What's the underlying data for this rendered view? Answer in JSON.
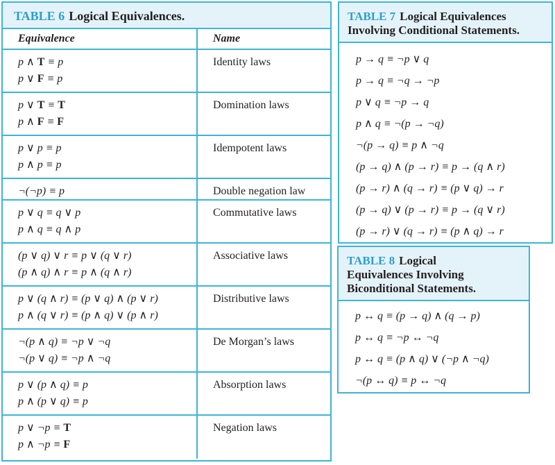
{
  "colors": {
    "border": "#3fb3d6",
    "header_bg": "#e4f3f9",
    "accent": "#2aa0cc",
    "text": "#231f20"
  },
  "table6": {
    "number": "TABLE 6",
    "title": "Logical Equivalences.",
    "headers": {
      "equivalence": "Equivalence",
      "name": "Name"
    },
    "rows": [
      {
        "lines": [
          "p ∧ <b>T</b> ≡ p",
          "p ∨ <b>F</b> ≡ p"
        ],
        "name": "Identity laws"
      },
      {
        "lines": [
          "p ∨ <b>T</b> ≡ <b>T</b>",
          "p ∧ <b>F</b> ≡ <b>F</b>"
        ],
        "name": "Domination laws"
      },
      {
        "lines": [
          "p ∨ p ≡ p",
          "p ∧ p ≡ p"
        ],
        "name": "Idempotent laws"
      },
      {
        "lines": [
          "¬(¬p) ≡ p"
        ],
        "name": "Double negation law"
      },
      {
        "lines": [
          "p ∨ q ≡ q ∨ p",
          "p ∧ q ≡ q ∧ p"
        ],
        "name": "Commutative laws"
      },
      {
        "lines": [
          "(p ∨ q) ∨ r ≡ p ∨ (q ∨ r)",
          "(p ∧ q) ∧ r ≡ p ∧ (q ∧ r)"
        ],
        "name": "Associative laws"
      },
      {
        "lines": [
          "p ∨ (q ∧ r) ≡ (p ∨ q) ∧ (p ∨ r)",
          "p ∧ (q ∨ r) ≡ (p ∧ q) ∨ (p ∧ r)"
        ],
        "name": "Distributive laws"
      },
      {
        "lines": [
          "¬(p ∧ q) ≡ ¬p ∨ ¬q",
          "¬(p ∨ q) ≡ ¬p ∧ ¬q"
        ],
        "name": "De Morgan’s laws"
      },
      {
        "lines": [
          "p ∨ (p ∧ q) ≡ p",
          "p ∧ (p ∨ q) ≡ p"
        ],
        "name": "Absorption laws"
      },
      {
        "lines": [
          "p ∨ ¬p ≡ <b>T</b>",
          "p ∧ ¬p ≡ <b>F</b>"
        ],
        "name": "Negation laws"
      }
    ]
  },
  "table7": {
    "number": "TABLE 7",
    "title_line1": "Logical Equivalences",
    "title_line2": "Involving Conditional Statements.",
    "lines": [
      "p → q ≡ ¬p ∨ q",
      "p → q ≡ ¬q → ¬p",
      "p ∨ q ≡ ¬p → q",
      "p ∧ q ≡ ¬(p → ¬q)",
      "¬(p → q) ≡ p ∧ ¬q",
      "(p → q) ∧ (p → r) ≡ p → (q ∧ r)",
      "(p → r) ∧ (q → r) ≡ (p ∨ q) → r",
      "(p → q) ∨ (p → r) ≡ p → (q ∨ r)",
      "(p → r) ∨ (q → r) ≡ (p ∧ q) → r"
    ]
  },
  "table8": {
    "number": "TABLE 8",
    "title_line1": "Logical",
    "title_line2": "Equivalences Involving",
    "title_line3": "Biconditional Statements.",
    "lines": [
      "p ↔ q ≡ (p → q) ∧ (q → p)",
      "p ↔ q ≡ ¬p ↔ ¬q",
      "p ↔ q ≡ (p ∧ q) ∨ (¬p ∧ ¬q)",
      "¬(p ↔ q) ≡ p ↔ ¬q"
    ]
  }
}
